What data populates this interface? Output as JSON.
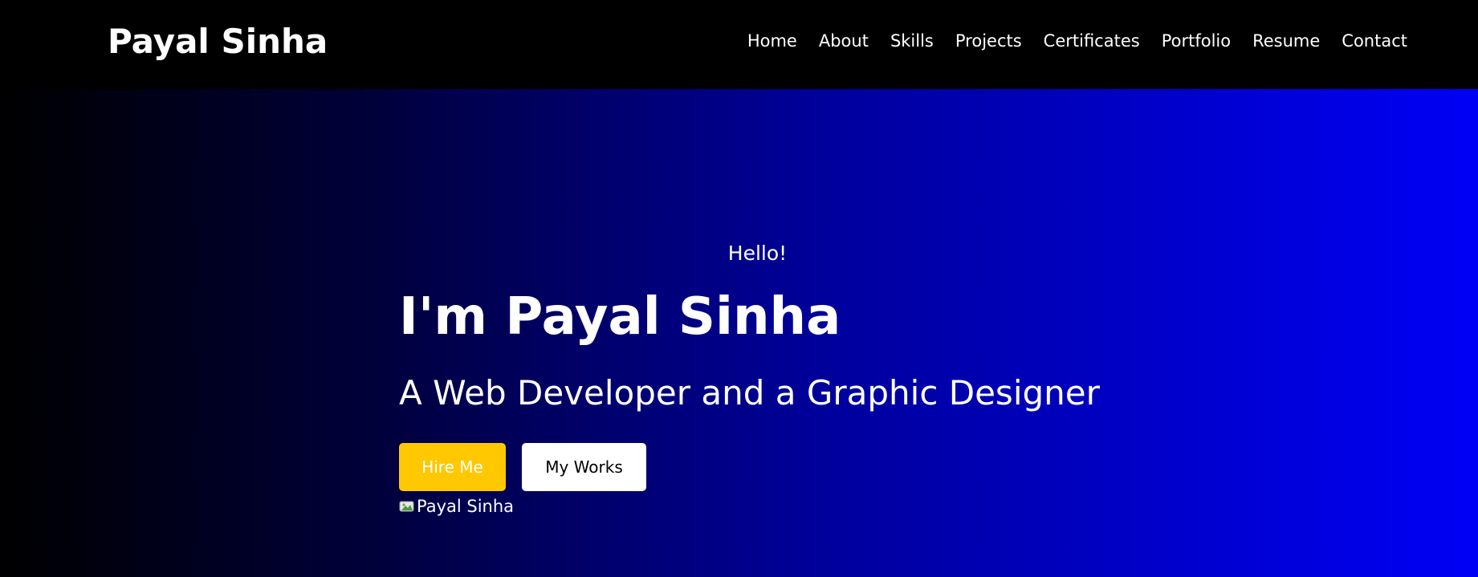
{
  "brand": "Payal Sinha",
  "nav": {
    "items": [
      "Home",
      "About",
      "Skills",
      "Projects",
      "Certificates",
      "Portfolio",
      "Resume",
      "Contact"
    ]
  },
  "hero": {
    "greeting": "Hello!",
    "name": "I'm Payal Sinha",
    "tagline": "A Web Developer and a Graphic Designer",
    "hire_label": "Hire Me",
    "works_label": "My Works",
    "image_alt": "Payal Sinha"
  },
  "colors": {
    "hire_button": "#ffc800",
    "gradient_end": "#0000f5"
  }
}
